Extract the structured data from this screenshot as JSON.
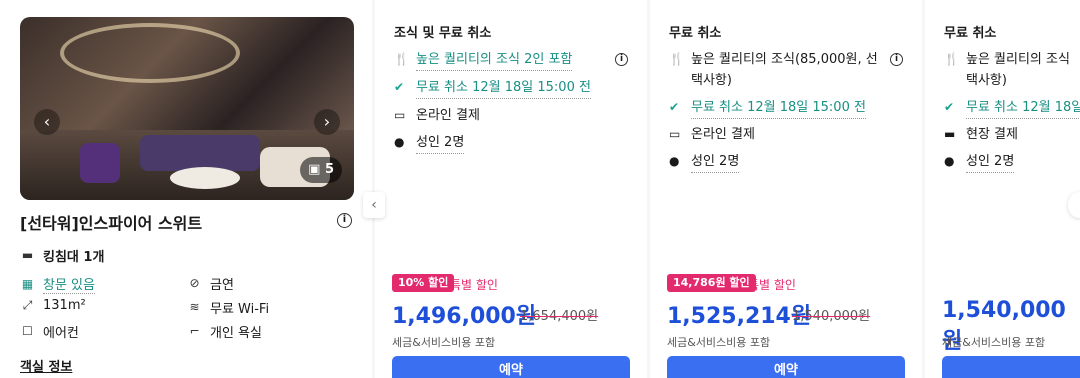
{
  "room": {
    "photo_count": "5",
    "title": "[선타워]인스파이어 스위트",
    "bed": "킹침대 1개",
    "window": "창문 있음",
    "smoking": "금연",
    "size": "131m²",
    "wifi": "무료 Wi-Fi",
    "aircon": "에어컨",
    "bath": "개인 욕실",
    "room_info_link": "객실 정보"
  },
  "rates": [
    {
      "title": "조식 및 무료 취소",
      "breakfast": "높은 퀄리티의 조식 2인 포함",
      "cancel": "무료 취소 12월 18일 15:00 전",
      "payment": "온라인 결제",
      "guests": "성인 2명",
      "badge": "10% 할인",
      "special": "특별 할인",
      "price": "1,496,000원",
      "original": "1,654,400원",
      "tax": "세금&서비스비용 포함",
      "book": "예약"
    },
    {
      "title": "무료 취소",
      "breakfast_line1": "높은 퀄리티의 조식(85,000원, 선",
      "breakfast_line2": "택사항)",
      "cancel": "무료 취소 12월 18일 15:00 전",
      "payment": "온라인 결제",
      "guests": "성인 2명",
      "badge": "14,786원 할인",
      "special": "특별 할인",
      "price": "1,525,214원",
      "original": "1,540,000원",
      "tax": "세금&서비스비용 포함",
      "book": "예약"
    },
    {
      "title": "무료 취소",
      "breakfast_line1": "높은 퀄리티의 조식",
      "breakfast_line2": "택사항)",
      "cancel": "무료 취소 12월 18일",
      "payment": "현장 결제",
      "guests": "성인 2명",
      "price": "1,540,000원",
      "tax": "세금&서비스비용 포함"
    }
  ]
}
